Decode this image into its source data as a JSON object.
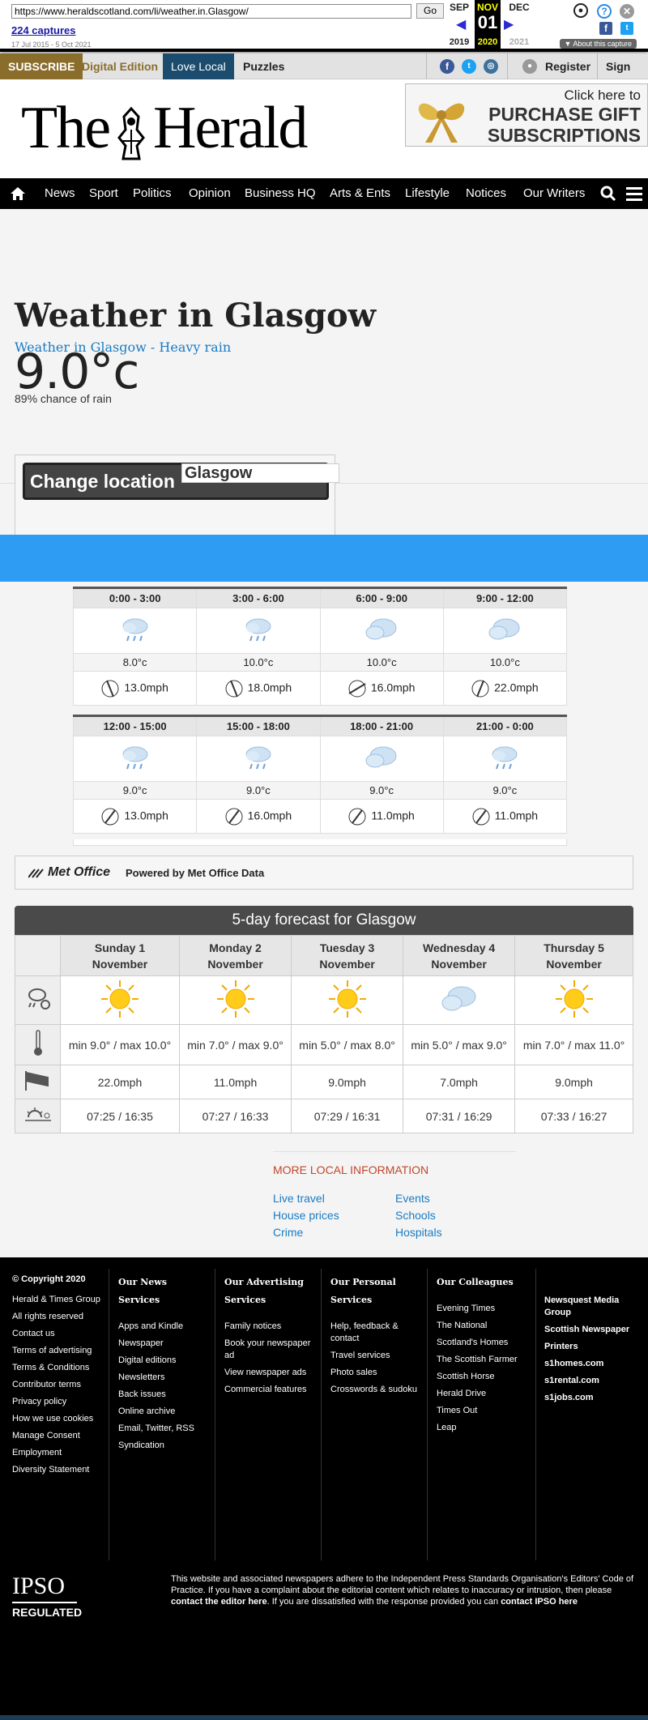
{
  "wayback": {
    "url": "https://www.heraldscotland.com/li/weather.in.Glasgow/",
    "go_label": "Go",
    "captures": "224 captures",
    "date_range": "17 Jul 2015 - 5 Oct 2021",
    "months": [
      "SEP",
      "NOV",
      "DEC"
    ],
    "day": "01",
    "years": [
      "2019",
      "2020",
      "2021"
    ],
    "about": "About this capture"
  },
  "topbar": {
    "subscribe": "SUBSCRIBE",
    "digital": "Digital Edition",
    "love_local": "Love Local",
    "puzzles": "Puzzles",
    "register": "Register",
    "sign_in": "Sign in"
  },
  "header": {
    "logo_left": "The",
    "logo_right": "Herald",
    "ad_line1": "Click here to",
    "ad_line2": "PURCHASE GIFT",
    "ad_line3": "SUBSCRIPTIONS"
  },
  "nav": {
    "items": [
      "News",
      "Sport",
      "Politics",
      "Opinion",
      "Business HQ",
      "Arts & Ents",
      "Lifestyle",
      "Notices",
      "Our Writers"
    ]
  },
  "weather": {
    "title": "Weather in Glasgow",
    "subtitle": "Weather in Glasgow - Heavy rain",
    "temp": "9.0°c",
    "rain": "89% chance of rain",
    "change_location": "Change location",
    "location_value": "Glasgow"
  },
  "hourly": {
    "rows": [
      {
        "times": [
          "0:00 - 3:00",
          "3:00 - 6:00",
          "6:00 - 9:00",
          "9:00 - 12:00"
        ],
        "temps": [
          "8.0°c",
          "10.0°c",
          "10.0°c",
          "10.0°c"
        ],
        "winds": [
          "13.0mph",
          "18.0mph",
          "16.0mph",
          "22.0mph"
        ]
      },
      {
        "times": [
          "12:00 - 15:00",
          "15:00 - 18:00",
          "18:00 - 21:00",
          "21:00 - 0:00"
        ],
        "temps": [
          "9.0°c",
          "9.0°c",
          "9.0°c",
          "9.0°c"
        ],
        "winds": [
          "13.0mph",
          "16.0mph",
          "11.0mph",
          "11.0mph"
        ]
      }
    ]
  },
  "metoffice": {
    "logo": "Met Office",
    "powered": "Powered by Met Office Data"
  },
  "forecast": {
    "title": "5-day forecast for Glasgow",
    "days": [
      {
        "day": "Sunday 1",
        "month": "November",
        "minmax": "min 9.0° / max 10.0°",
        "wind": "22.0mph",
        "sun": "07:25 / 16:35"
      },
      {
        "day": "Monday 2",
        "month": "November",
        "minmax": "min 7.0° / max 9.0°",
        "wind": "11.0mph",
        "sun": "07:27 / 16:33"
      },
      {
        "day": "Tuesday 3",
        "month": "November",
        "minmax": "min 5.0° / max 8.0°",
        "wind": "9.0mph",
        "sun": "07:29 / 16:31"
      },
      {
        "day": "Wednesday 4",
        "month": "November",
        "minmax": "min 5.0° / max 9.0°",
        "wind": "7.0mph",
        "sun": "07:31 / 16:29"
      },
      {
        "day": "Thursday 5",
        "month": "November",
        "minmax": "min 7.0° / max 11.0°",
        "wind": "9.0mph",
        "sun": "07:33 / 16:27"
      }
    ]
  },
  "more": {
    "title": "MORE LOCAL INFORMATION",
    "links": [
      "Live travel",
      "Events",
      "House prices",
      "Schools",
      "Crime",
      "Hospitals"
    ]
  },
  "footer": {
    "col1": [
      "© Copyright 2020",
      "Herald & Times Group",
      "All rights reserved",
      "Contact us",
      "Terms of advertising",
      "Terms & Conditions",
      "Contributor terms",
      "Privacy policy",
      "How we use cookies",
      "Manage Consent",
      "Employment",
      "Diversity Statement"
    ],
    "col2_title": "Our News Services",
    "col2": [
      "Apps and Kindle",
      "Newspaper",
      "Digital editions",
      "Newsletters",
      "Back issues",
      "Online archive",
      "Email, Twitter, RSS",
      "Syndication"
    ],
    "col3_title": "Our Advertising Services",
    "col3": [
      "Family notices",
      "Book your newspaper ad",
      "View newspaper ads",
      "Commercial features"
    ],
    "col4_title": "Our Personal Services",
    "col4": [
      "Help, feedback & contact",
      "Travel services",
      "Photo sales",
      "Crosswords & sudoku"
    ],
    "col5_title": "Our Colleagues",
    "col5": [
      "Evening Times",
      "The National",
      "Scotland's Homes",
      "The Scottish Farmer",
      "Scottish Horse",
      "Herald Drive",
      "Times Out",
      "Leap"
    ],
    "col6": [
      "Newsquest Media Group",
      "Scottish Newspaper",
      "Printers",
      "s1homes.com",
      "s1rental.com",
      "s1jobs.com"
    ],
    "ipso": "IPSO",
    "regulated": "REGULATED",
    "ipso_text_1": "This website and associated newspapers adhere to the Independent Press Standards Organisation's Editors' Code of Practice. If you have a complaint about the editorial content which relates to inaccuracy or intrusion, then please ",
    "ipso_link_1": "contact the editor here",
    "ipso_text_2": ". If you are dissatisfied with the response provided you can ",
    "ipso_link_2": "contact IPSO here"
  }
}
